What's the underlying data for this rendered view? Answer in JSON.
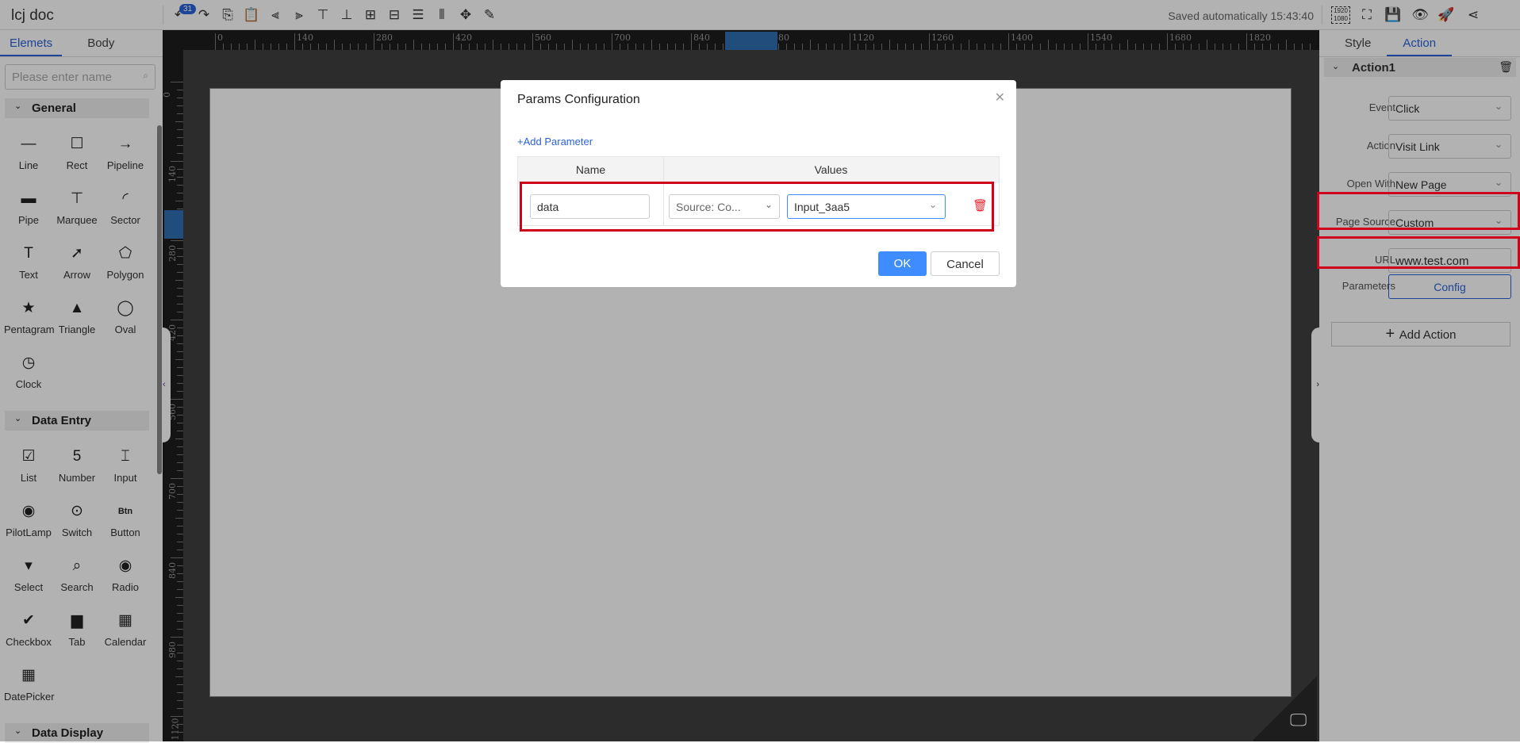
{
  "app": {
    "title": "lcj doc",
    "saved": "Saved automatically 15:43:40",
    "undo_count": "31",
    "resolution_top": "1920",
    "resolution_bottom": "1080"
  },
  "toolbar": {
    "icons": [
      "undo-icon",
      "redo-icon",
      "copy-icon",
      "paste-icon",
      "align-left-icon",
      "align-right-icon",
      "align-top-icon",
      "align-bottom-icon",
      "align-hcenter-icon",
      "align-vcenter-icon",
      "distribute-h-icon",
      "distribute-v-icon",
      "move-icon",
      "brush-icon"
    ],
    "right_icons": [
      "resolution-icon",
      "fit-screen-icon",
      "save-icon",
      "preview-icon",
      "publish-icon",
      "share-icon"
    ]
  },
  "left": {
    "tabs": [
      "Elemets",
      "Body"
    ],
    "search_placeholder": "Please enter name",
    "sections": [
      {
        "title": "General",
        "items": [
          {
            "label": "Line",
            "icon": "—"
          },
          {
            "label": "Rect",
            "icon": "☐"
          },
          {
            "label": "Pipeline",
            "icon": "→"
          },
          {
            "label": "Pipe",
            "icon": "▬"
          },
          {
            "label": "Marquee",
            "icon": "⊤"
          },
          {
            "label": "Sector",
            "icon": "◜"
          },
          {
            "label": "Text",
            "icon": "T"
          },
          {
            "label": "Arrow",
            "icon": "➚"
          },
          {
            "label": "Polygon",
            "icon": "⬠"
          },
          {
            "label": "Pentagram",
            "icon": "★"
          },
          {
            "label": "Triangle",
            "icon": "▲"
          },
          {
            "label": "Oval",
            "icon": "◯"
          },
          {
            "label": "Clock",
            "icon": "◷"
          }
        ]
      },
      {
        "title": "Data Entry",
        "items": [
          {
            "label": "List",
            "icon": "☑"
          },
          {
            "label": "Number",
            "icon": "5"
          },
          {
            "label": "Input",
            "icon": "⌶"
          },
          {
            "label": "PilotLamp",
            "icon": "◉"
          },
          {
            "label": "Switch",
            "icon": "⊙"
          },
          {
            "label": "Button",
            "icon": "Btn"
          },
          {
            "label": "Select",
            "icon": "▾"
          },
          {
            "label": "Search",
            "icon": "⌕"
          },
          {
            "label": "Radio",
            "icon": "◉"
          },
          {
            "label": "Checkbox",
            "icon": "✔"
          },
          {
            "label": "Tab",
            "icon": "▆"
          },
          {
            "label": "Calendar",
            "icon": "▦"
          },
          {
            "label": "DatePicker",
            "icon": "▦"
          }
        ]
      },
      {
        "title": "Data Display",
        "items": []
      }
    ]
  },
  "rulers": {
    "h": [
      "0",
      "140",
      "280",
      "420",
      "560",
      "700",
      "840",
      "980",
      "1120",
      "1260",
      "1400",
      "1540",
      "1680",
      "1820"
    ],
    "v": [
      "0",
      "140",
      "280",
      "420",
      "560",
      "700",
      "840",
      "980",
      "1120"
    ]
  },
  "right": {
    "tabs": [
      "Style",
      "Action"
    ],
    "action_title": "Action1",
    "rows": [
      {
        "label": "Event",
        "value": "Click"
      },
      {
        "label": "Action",
        "value": "Visit Link"
      },
      {
        "label": "Open With",
        "value": "New Page"
      },
      {
        "label": "Page Source",
        "value": "Custom"
      }
    ],
    "url_label": "URL",
    "url_value": "www.test.com",
    "params_label": "Parameters",
    "config": "Config",
    "add_action": "Add Action"
  },
  "dialog": {
    "title": "Params Configuration",
    "add_param": "Add Parameter",
    "col_name": "Name",
    "col_values": "Values",
    "row": {
      "name": "data",
      "source": "Source:  Co...",
      "value": "Input_3aa5"
    },
    "ok": "OK",
    "cancel": "Cancel"
  },
  "colors": {
    "accent": "#2b62d9",
    "primary_button": "#3f8cff",
    "highlight": "#d0021b",
    "danger": "#f5222d"
  }
}
